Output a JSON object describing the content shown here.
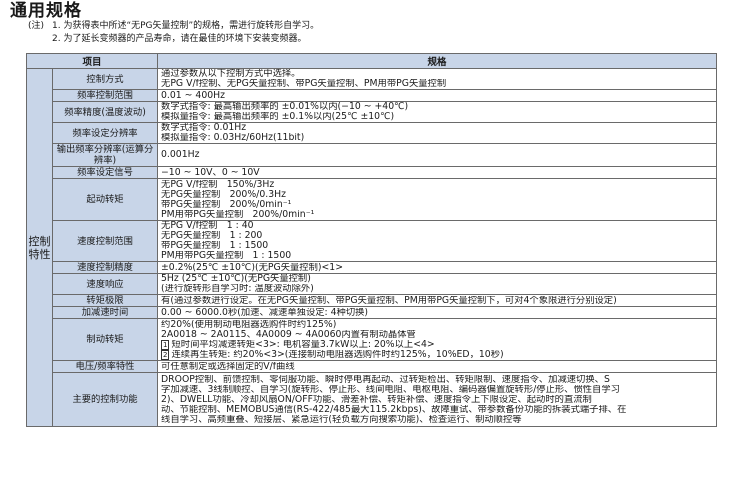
{
  "page": {
    "title": "通用规格",
    "notes": {
      "prefix": "(注)",
      "note1": "1. 为获得表中所述“无PG矢量控制”的规格，需进行旋转形自学习。",
      "note2": "2. 为了延长变频器的产品寿命，请在最佳的环境下安装变频器。"
    }
  },
  "table": {
    "header_item": "项目",
    "header_spec": "规格",
    "group_label": "控制特性",
    "rows": [
      {
        "item": "控制方式",
        "lines": [
          "通过参数从以下控制方式中选择。",
          "无PG V/f控制、无PG矢量控制、带PG矢量控制、PM用带PG矢量控制"
        ]
      },
      {
        "item": "频率控制范围",
        "lines": [
          "0.01 ~ 400Hz"
        ]
      },
      {
        "item": "频率精度(温度波动)",
        "lines": [
          "数字式指令: 最高输出频率的 ±0.01%以内(−10 ~ +40℃)",
          "模拟量指令: 最高输出频率的 ±0.1%以内(25℃ ±10℃)"
        ]
      },
      {
        "item": "频率设定分辨率",
        "lines": [
          "数字式指令: 0.01Hz",
          "模拟量指令: 0.03Hz/60Hz(11bit)"
        ]
      },
      {
        "item": "输出频率分辨率(运算分辨率)",
        "lines": [
          "0.001Hz"
        ]
      },
      {
        "item": "频率设定信号",
        "lines": [
          "−10 ~ 10V、0 ~ 10V"
        ]
      },
      {
        "item": "起动转矩",
        "lines": [
          "无PG V/f控制　150%/3Hz",
          "无PG矢量控制　200%/0.3Hz",
          "带PG矢量控制　200%/0min⁻¹",
          "PM用带PG矢量控制　200%/0min⁻¹"
        ]
      },
      {
        "item": "速度控制范围",
        "lines": [
          "无PG V/f控制　1 : 40",
          "无PG矢量控制　1 : 200",
          "带PG矢量控制　1 : 1500",
          "PM用带PG矢量控制　1 : 1500"
        ]
      },
      {
        "item": "速度控制精度",
        "lines": [
          "±0.2%(25℃ ±10℃)(无PG矢量控制)<1>"
        ]
      },
      {
        "item": "速度响应",
        "lines": [
          "5Hz (25℃ ±10℃)(无PG矢量控制)",
          "(进行旋转形自学习时: 温度波动除外)"
        ]
      },
      {
        "item": "转矩极限",
        "lines": [
          "有(通过参数进行设定。在无PG矢量控制、带PG矢量控制、PM用带PG矢量控制下，可对4个象限进行分别设定)"
        ]
      },
      {
        "item": "加减速时间",
        "lines": [
          "0.00 ~ 6000.0秒(加速、减速单独设定: 4种切换)"
        ]
      },
      {
        "item": "制动转矩",
        "lines": [
          "约20%(使用制动电阻器选购件时约125%)",
          "2A0018 ~ 2A0115、4A0009 ~ 4A0060内置有制动晶体管",
          "短时间平均减速转矩<3>: 电机容量3.7kW以上: 20%以上<4>",
          "连续再生转矩: 约20%<3>(连接制动电阻器选购件时约125%，10%ED，10秒)"
        ]
      },
      {
        "item": "电压/频率特性",
        "lines": [
          "可任意制定或选择固定的V/f曲线"
        ]
      },
      {
        "item": "主要的控制功能",
        "lines": [
          "DROOP控制、前馈控制、零伺服功能、瞬时停电再起动、过转矩检出、转矩限制、速度指令、加减速切换、S",
          "字加减速、3线制顺控、自学习(旋转形、停止形、线间电阻、电枢电阻、编码器偏置旋转形/停止形、惯性自学习",
          "2)、DWELL功能、冷却风扇ON/OFF功能、滑差补偿、转矩补偿、速度指令上下限设定、起动时的直流制",
          "动、节能控制、MEMOBUS通信(RS-422/485最大115.2kbps)、故障重试、带参数备份功能的拆装式端子排、在",
          "线自学习、高频重叠、短接层、紧急运行(轻负载方向搜索功能)、检查运行、制动顺控等"
        ]
      }
    ],
    "circled_marks": [
      "1",
      "2"
    ]
  }
}
